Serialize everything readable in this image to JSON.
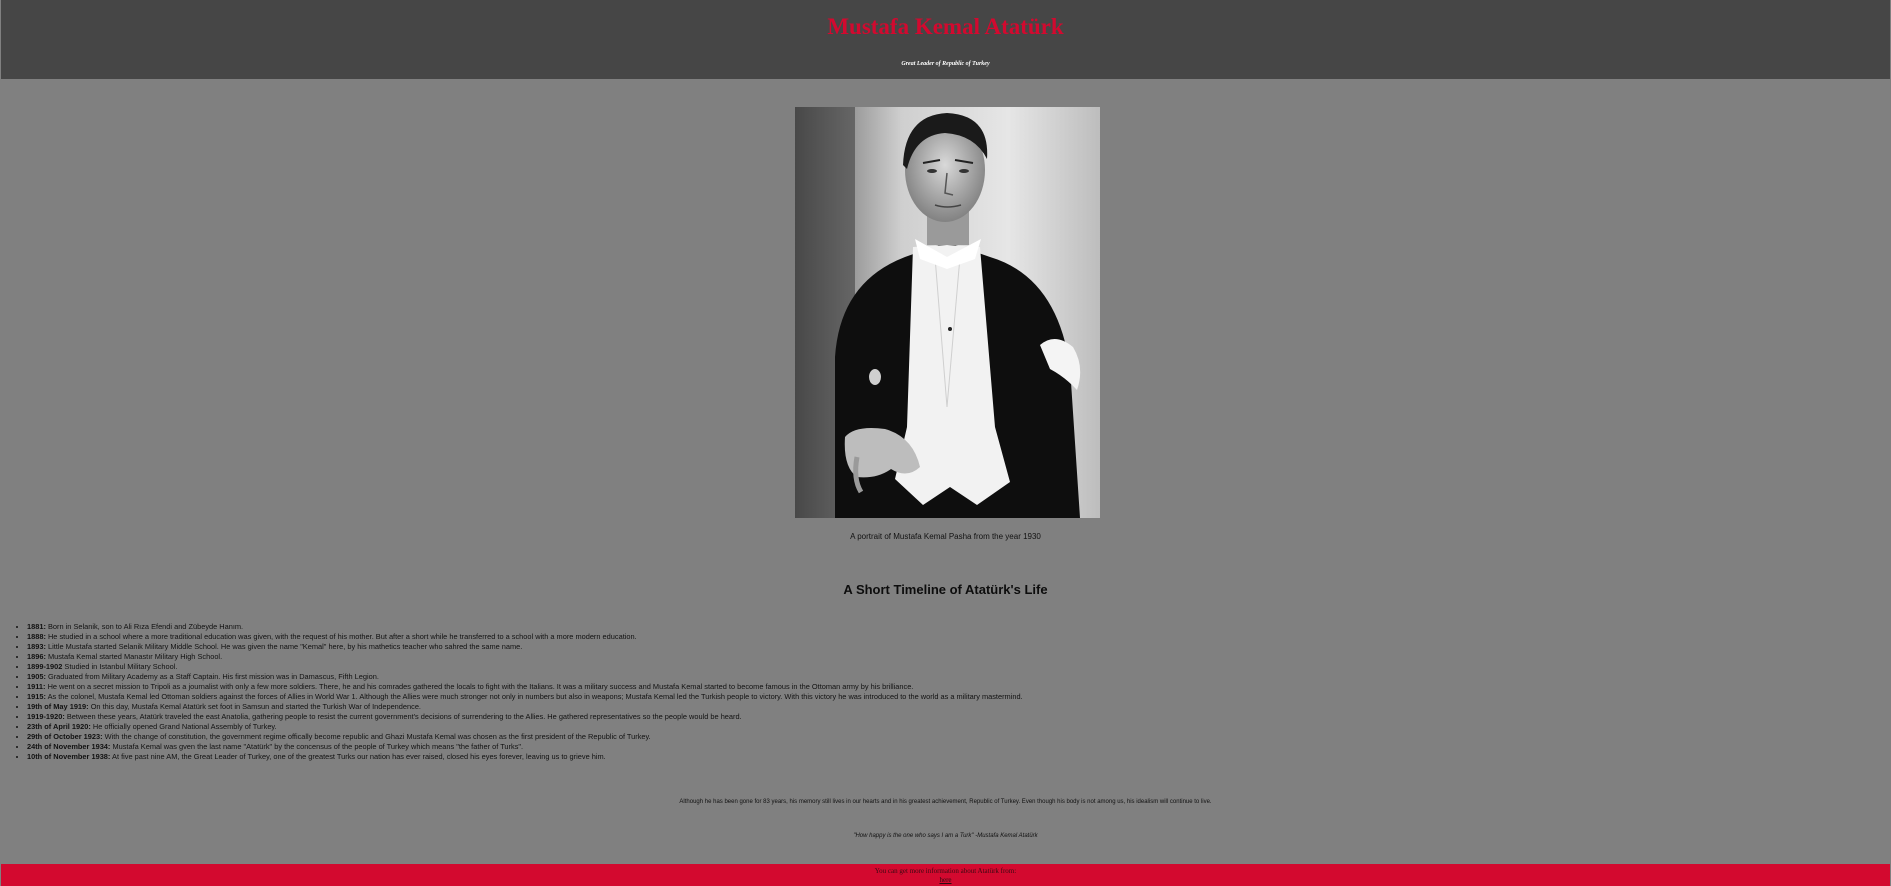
{
  "header": {
    "title": "Mustafa Kemal Atatürk",
    "subtitle": "Great Leader of Republic of Turkey"
  },
  "portrait": {
    "icon": "portrait-photo"
  },
  "caption": "A portrait of Mustafa Kemal Pasha from the year 1930",
  "timeline": {
    "heading": "A Short Timeline of Atatürk's Life",
    "items": [
      {
        "date": "1881:",
        "text": "Born in Selanik, son to Ali Rıza Efendi and Zübeyde Hanım."
      },
      {
        "date": "1888:",
        "text": "He studied in a school where a more traditional education was given, with the request of his mother. But after a short while he transferred to a school with a more modern education."
      },
      {
        "date": "1893:",
        "text": "Little Mustafa started Selanik Military Middle School. He was given the name \"Kemal\" here, by his mathetics teacher who sahred the same name."
      },
      {
        "date": "1896:",
        "text": "Mustafa Kemal started Manastır Military High School."
      },
      {
        "date": "1899-1902",
        "text": "Studied in Istanbul Military School."
      },
      {
        "date": "1905:",
        "text": "Graduated from Military Academy as a Staff Captain. His first mission was in Damascus, Fifth Legion."
      },
      {
        "date": "1911:",
        "text": "He went on a secret mission to Tripoli as a journalist with only a few more soldiers. There, he and his comrades gathered the locals to fight with the Italians. It was a military success and Mustafa Kemal started to become famous in the Ottoman army by his brilliance."
      },
      {
        "date": "1915:",
        "text": "As the colonel, Mustafa Kemal led Ottoman soldiers against the forces of Allies in World War 1. Although the Allies were much stronger not only in numbers but also in weapons; Mustafa Kemal led the Turkish people to victory. With this victory he was introduced to the world as a military mastermind."
      },
      {
        "date": "19th of May 1919:",
        "text": "On this day, Mustafa Kemal Atatürk set foot in Samsun and started the Turkish War of Independence."
      },
      {
        "date": "1919-1920:",
        "text": "Between these years, Atatürk traveled the east Anatolia, gathering people to resist the current government's decisions of surrendering to the Allies. He gathered representatives so the people would be heard."
      },
      {
        "date": "23th of April 1920:",
        "text": "He officially opened Grand National Assembly of Turkey."
      },
      {
        "date": "29th of October 1923:",
        "text": "With the change of constitution, the government regime offically become republic and Ghazi Mustafa Kemal was chosen as the first president of the Republic of Turkey."
      },
      {
        "date": "24th of November 1934:",
        "text": "Mustafa Kemal was gven the last name \"Atatürk\" by the concensus of the people of Turkey which means \"the father of Turks\"."
      },
      {
        "date": "10th of November 1938:",
        "text": "At five past nine AM, the Great Leader of Turkey, one of the greatest Turks our nation has ever raised, closed his eyes forever, leaving us to grieve him."
      }
    ]
  },
  "closing": "Although he has been gone for 83 years, his memory still lives in our hearts and in his greatest achievement, Republic of Turkey. Even though his body is not among us, his idealism will continue to live.",
  "quote": "\"How happy is the one who says I am a Turk\" -Mustafa Kemal Atatürk",
  "footer": {
    "text": "You can get more information about Atatürk from:",
    "link_label": "here"
  },
  "colors": {
    "header_bg": "#464646",
    "page_bg": "#808080",
    "accent_red": "#d3092f"
  }
}
